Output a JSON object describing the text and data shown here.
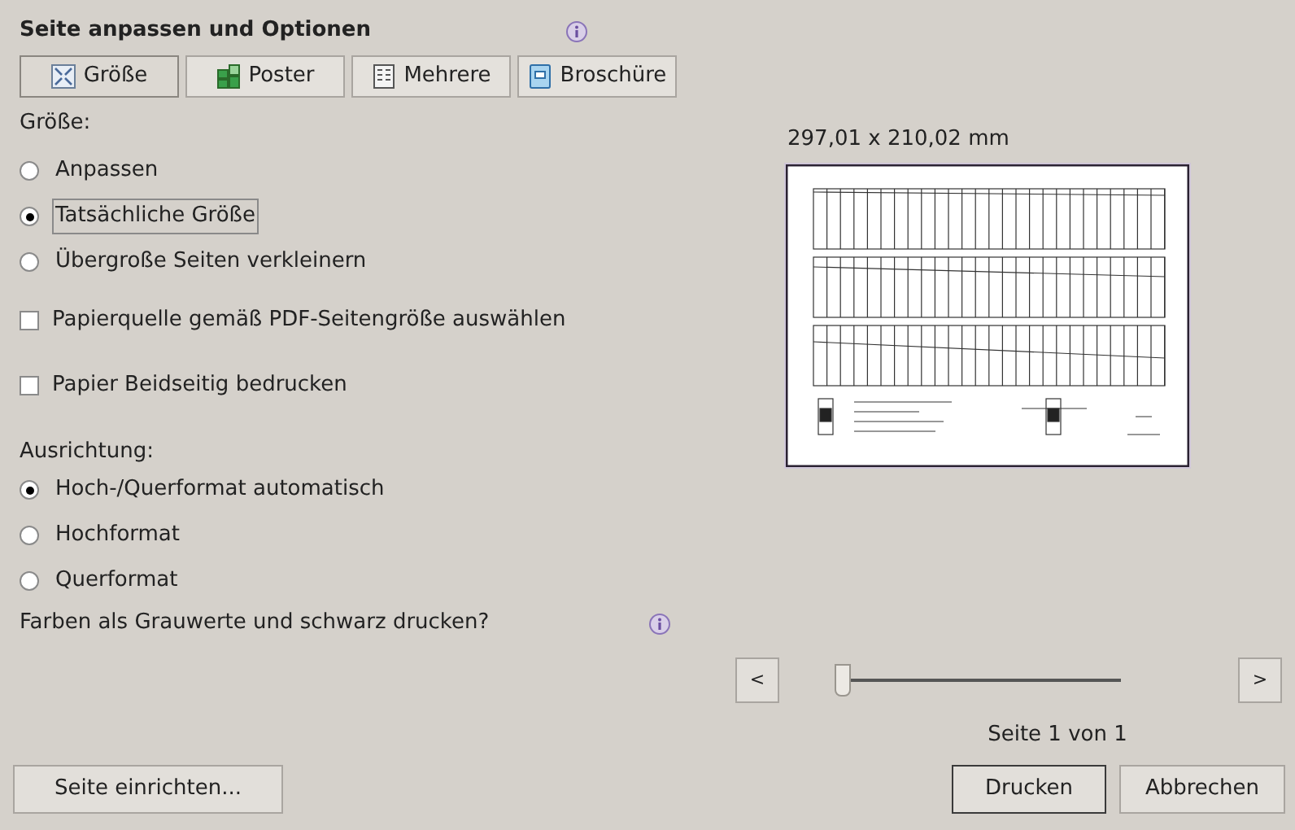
{
  "section_title": "Seite anpassen und Optionen",
  "tabs": [
    {
      "label": "Größe",
      "kind": "size",
      "selected": true
    },
    {
      "label": "Poster",
      "kind": "poster",
      "selected": false
    },
    {
      "label": "Mehrere",
      "kind": "multiple",
      "selected": false
    },
    {
      "label": "Broschüre",
      "kind": "booklet",
      "selected": false
    }
  ],
  "size_label": "Größe:",
  "size_options": [
    {
      "label": "Anpassen",
      "selected": false,
      "focused": false
    },
    {
      "label": "Tatsächliche Größe",
      "selected": true,
      "focused": true
    },
    {
      "label": "Übergroße Seiten verkleinern",
      "selected": false,
      "focused": false
    }
  ],
  "checkboxes": [
    {
      "label": "Papierquelle gemäß PDF-Seitengröße auswählen",
      "checked": false
    },
    {
      "label": "Papier Beidseitig bedrucken",
      "checked": false
    }
  ],
  "orientation_label": "Ausrichtung:",
  "orientation_options": [
    {
      "label": "Hoch-/Querformat automatisch",
      "selected": true
    },
    {
      "label": "Hochformat",
      "selected": false
    },
    {
      "label": "Querformat",
      "selected": false
    }
  ],
  "grayscale_label": "Farben als Grauwerte und schwarz drucken?",
  "preview": {
    "dimensions": "297,01 x 210,02 mm",
    "prev_button": "<",
    "next_button": ">",
    "page_slider": {
      "level": 0
    },
    "page_label": "Seite 1 von 1"
  },
  "buttons": {
    "setup": "Seite einrichten...",
    "print": "Drucken",
    "cancel": "Abbrechen"
  }
}
